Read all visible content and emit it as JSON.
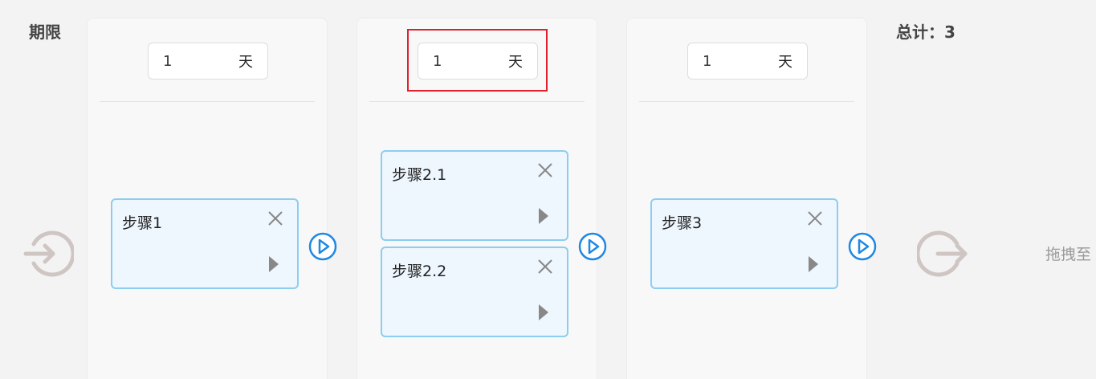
{
  "header": {
    "deadline_label": "期限",
    "total_label": "总计：3"
  },
  "stages": [
    {
      "days": "1",
      "unit": "天",
      "steps": [
        {
          "title": "步骤1"
        }
      ]
    },
    {
      "days": "1",
      "unit": "天",
      "steps": [
        {
          "title": "步骤2.1"
        },
        {
          "title": "步骤2.2"
        }
      ]
    },
    {
      "days": "1",
      "unit": "天",
      "steps": [
        {
          "title": "步骤3"
        }
      ]
    }
  ],
  "drag_hint": "拖拽至",
  "colors": {
    "card_border": "#8ccdf0",
    "card_bg": "#eef6fe",
    "accent_blue": "#1e88e5",
    "highlight_red": "#e0202a",
    "io_gray": "#cfc6c4"
  },
  "icons": {
    "entry": "sign-in-icon",
    "exit": "sign-out-icon",
    "connector": "play-circle-icon",
    "close": "close-icon",
    "play": "play-triangle-icon"
  }
}
